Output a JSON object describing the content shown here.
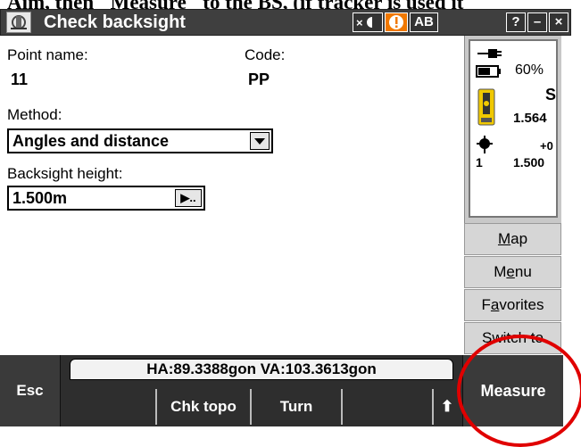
{
  "caption_text": "Aim, then \"Measure\" to the BS, (if tracker is used it",
  "titlebar": {
    "title": "Check backsight",
    "btn_ab": "AB",
    "btn_help": "?",
    "btn_min": "–",
    "btn_close": "×"
  },
  "form": {
    "point_name_label": "Point name:",
    "point_name_value": "11",
    "code_label": "Code:",
    "code_value": "PP",
    "method_label": "Method:",
    "method_value": "Angles and distance",
    "backsight_height_label": "Backsight height:",
    "backsight_height_value": "1.500m",
    "picker_glyph": "▶.."
  },
  "status_panel": {
    "battery_percent": "60%",
    "instrument_letter": "S",
    "instrument_value": "1.564",
    "target_offset": "+0",
    "target_id": "1",
    "target_height": "1.500"
  },
  "side_buttons": {
    "map": {
      "underlined": "M",
      "rest": "ap"
    },
    "menu": {
      "before": "M",
      "underlined": "e",
      "rest": "nu"
    },
    "favorites": {
      "before": "F",
      "underlined": "a",
      "rest": "vorites"
    },
    "switch_to": "Switch to"
  },
  "bottom": {
    "esc": "Esc",
    "angles": "HA:89.3388gon  VA:103.3613gon",
    "chk_topo": "Chk topo",
    "turn": "Turn",
    "up_arrow": "⬆",
    "measure": "Measure"
  },
  "colors": {
    "titlebar_bg": "#3f3f3f",
    "highlight_circle": "#e00000",
    "alert_orange": "#f07800",
    "prism_yellow": "#f0c800"
  }
}
